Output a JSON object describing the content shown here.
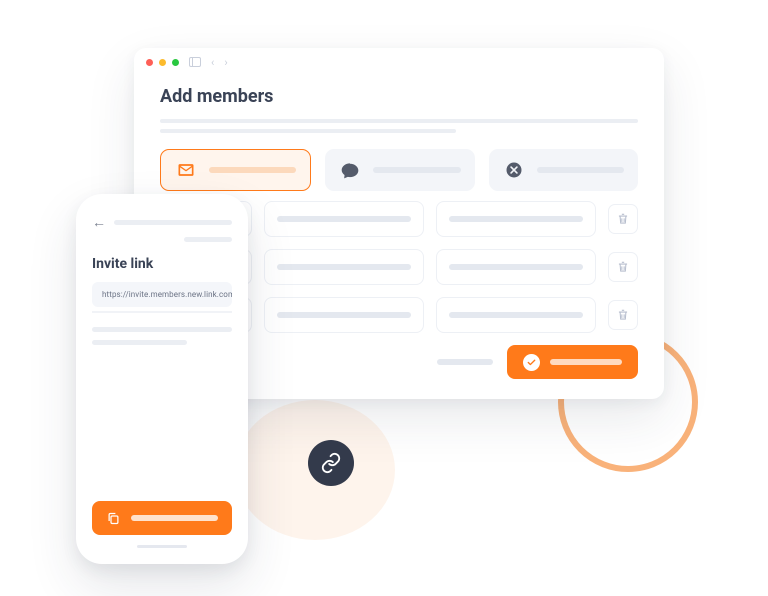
{
  "window": {
    "title": "Add members",
    "tabs": [
      {
        "icon": "mail-icon",
        "active": true
      },
      {
        "icon": "chat-icon",
        "active": false
      },
      {
        "icon": "cancel-icon",
        "active": false
      }
    ],
    "rows": 3,
    "cta_icon": "check-icon"
  },
  "phone": {
    "title": "Invite link",
    "link_value": "https://invite.members.new.link.com",
    "copy_icon": "copy-icon"
  },
  "badge": {
    "icon": "link-icon"
  }
}
